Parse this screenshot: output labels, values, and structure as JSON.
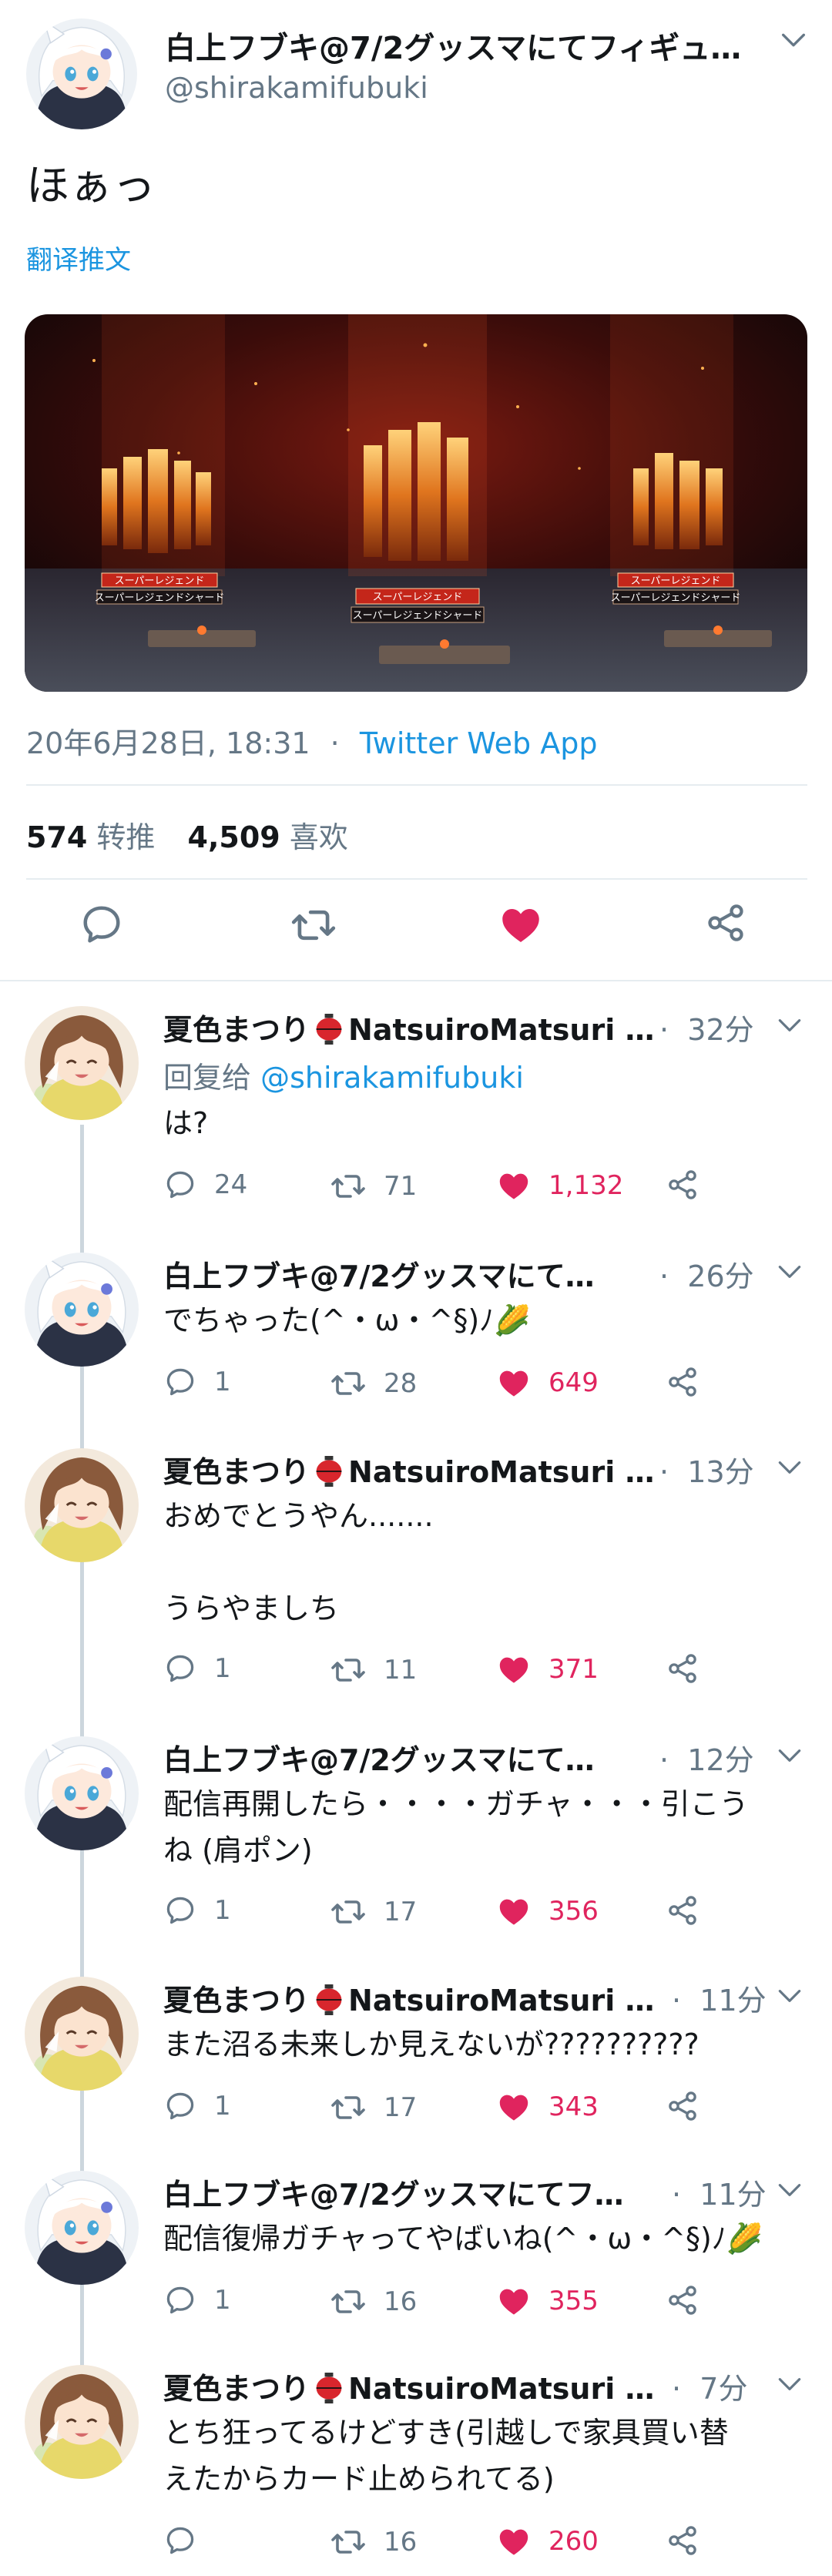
{
  "main_tweet": {
    "author_name": "白上フブキ@7/2グッスマにてフィギュ…",
    "handle": "@shirakamifubuki",
    "text": "ほぁっ",
    "translate_label": "翻译推文",
    "timestamp": "20年6月28日, 18:31",
    "meta_sep": "·",
    "source": "Twitter Web App",
    "retweets": "574",
    "retweets_label": "转推",
    "likes": "4,509",
    "likes_label": "喜欢",
    "media": {
      "plaque_top_labels": [
        "スーパーレジェンド",
        "スーパーレジェンド",
        "スーパーレジェンド"
      ],
      "plaque_bottom_labels": [
        "スーパーレジェンドシャード",
        "スーパーレジェンドシャード",
        "スーパーレジェンドシャード"
      ]
    }
  },
  "icons": {
    "reply": "speech-bubble-icon",
    "retweet": "retweet-arrows-icon",
    "like": "heart-icon",
    "share": "share-nodes-icon",
    "more": "chevron-down-icon"
  },
  "colors": {
    "link_blue": "#1b95e0",
    "like_red": "#e0245e",
    "secondary": "#657786"
  },
  "replies": [
    {
      "author_name": "夏色まつり",
      "author_name_suffix": "NatsuiroMatsuri …",
      "time_sep": "·",
      "time": "32分",
      "reply_to_prefix": "回复给",
      "reply_to": "@shirakamifubuki",
      "text_lines": [
        "は?"
      ],
      "replies": "24",
      "retweets": "71",
      "likes": "1,132"
    },
    {
      "author_name": "白上フブキ@7/2グッスマにて…",
      "time_sep": "·",
      "time": "26分",
      "text_lines": [
        "でちゃった(^・ω・^§)ﾉ🌽"
      ],
      "replies": "1",
      "retweets": "28",
      "likes": "649"
    },
    {
      "author_name": "夏色まつり",
      "author_name_suffix": "NatsuiroMatsuri …",
      "time_sep": "·",
      "time": "13分",
      "text_lines": [
        "おめでとうやん.......",
        "",
        "うらやましち"
      ],
      "replies": "1",
      "retweets": "11",
      "likes": "371"
    },
    {
      "author_name": "白上フブキ@7/2グッスマにて…",
      "time_sep": "·",
      "time": "12分",
      "text_lines": [
        "配信再開したら・・・・ガチャ・・・引こう",
        "ね (肩ポン)"
      ],
      "replies": "1",
      "retweets": "17",
      "likes": "356"
    },
    {
      "author_name": "夏色まつり",
      "author_name_suffix": "NatsuiroMatsuri …",
      "time_sep": "·",
      "time": "11分",
      "text_lines": [
        "また沼る未来しか見えないが??????????"
      ],
      "replies": "1",
      "retweets": "17",
      "likes": "343"
    },
    {
      "author_name": "白上フブキ@7/2グッスマにてフ…",
      "time_sep": "·",
      "time": "11分",
      "text_lines": [
        "配信復帰ガチャってやばいね(^・ω・^§)ﾉ🌽"
      ],
      "replies": "1",
      "retweets": "16",
      "likes": "355"
    },
    {
      "author_name": "夏色まつり",
      "author_name_suffix": "NatsuiroMatsuri …",
      "time_sep": "·",
      "time": "7分",
      "text_lines": [
        "とち狂ってるけどすき(引越しで家具買い替",
        "えたからカード止められてる)"
      ],
      "replies": "",
      "retweets": "16",
      "likes": "260"
    }
  ]
}
